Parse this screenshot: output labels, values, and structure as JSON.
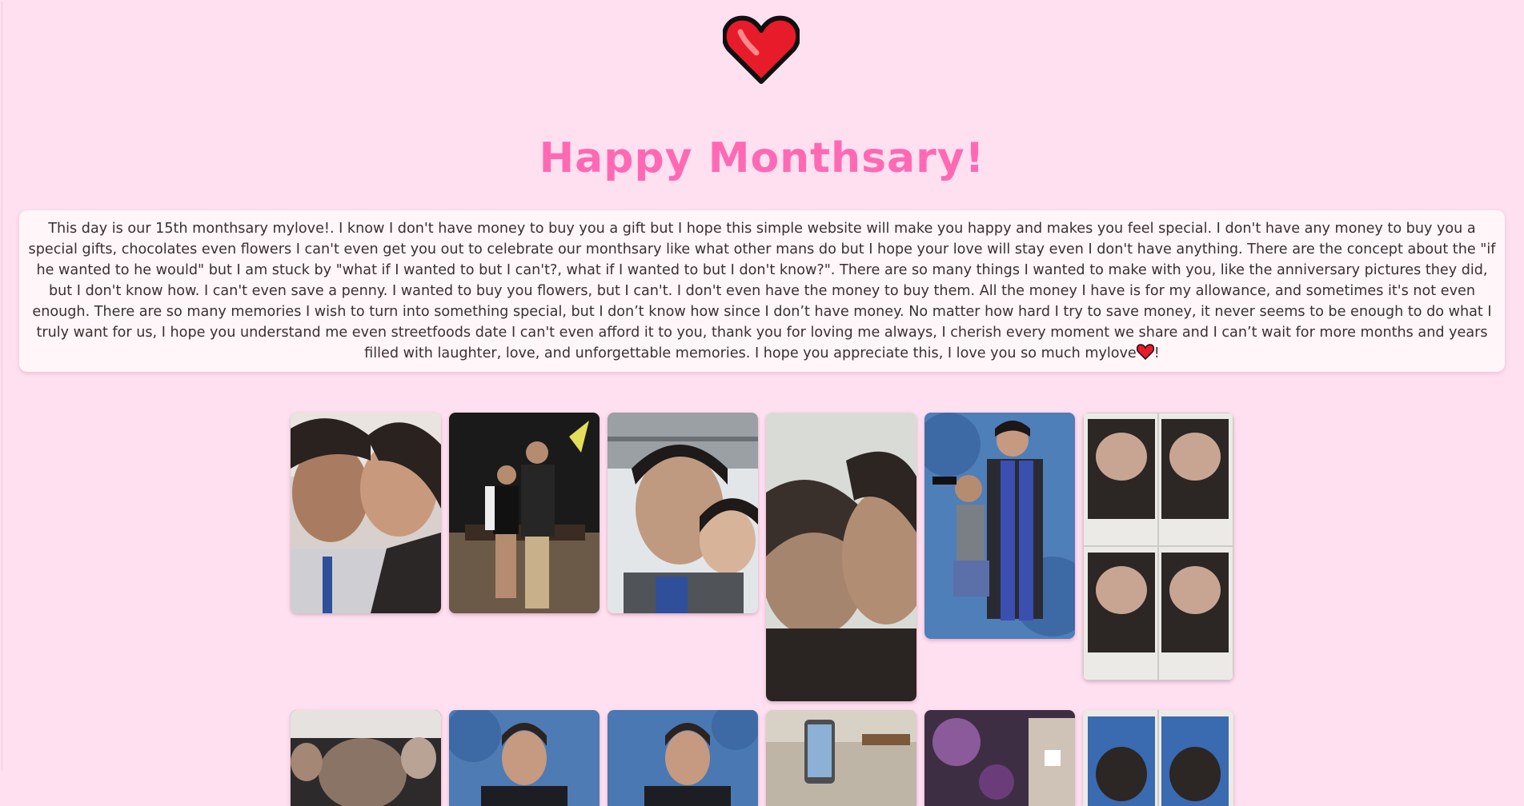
{
  "header": {
    "heart_icon": "red-heart-icon",
    "title": "Happy Monthsary!"
  },
  "letter": {
    "body": "This day is our 15th monthsary mylove!. I know I don't have money to buy you a gift but I hope this simple website will make you happy and makes you feel special. I don't have any money to buy you a special gifts, chocolates even flowers I can't even get you out to celebrate our monthsary like what other mans do but I hope your love will stay even I don't have anything. There are the concept about the \"if he wanted to he would\" but I am stuck by \"what if I wanted to but I can't?, what if I wanted to but I don't know?\". There are so many things I wanted to make with you, like the anniversary pictures they did, but I don't know how. I can't even save a penny. I wanted to buy you flowers, but I can't. I don't even have the money to buy them. All the money I have is for my allowance, and sometimes it's not even enough. There are so many memories I wish to turn into something special, but I don’t know how since I don’t have money. No matter how hard I try to save money, it never seems to be enough to do what I truly want for us, I hope you understand me even streetfoods date I can't even afford it to you, thank you for loving me always, I cherish every moment we share and I can’t wait for more months and years filled with laughter, love, and unforgettable memories. I hope you appreciate this, I love you so much mylove",
    "ending": "!",
    "ending_icon": "red-heart-icon"
  },
  "gallery": {
    "photos": [
      {
        "name": "couple-selfie-photo",
        "palette": [
          "#6e5a52",
          "#b98f79",
          "#d7d0cc"
        ]
      },
      {
        "name": "couple-night-photo",
        "palette": [
          "#1a1a1a",
          "#6b5a47",
          "#c7b08a"
        ]
      },
      {
        "name": "bus-selfie-photo",
        "palette": [
          "#9aa0a4",
          "#c8b1a0",
          "#e3e6e8"
        ]
      },
      {
        "name": "close-selfie-photo",
        "palette": [
          "#d9dcd6",
          "#5a4a40",
          "#2a2522"
        ]
      },
      {
        "name": "graduation-photo",
        "palette": [
          "#4f7fb8",
          "#2a2a33",
          "#3a4fb0"
        ]
      },
      {
        "name": "photobooth-strip-photo",
        "palette": [
          "#eceae6",
          "#2c2624",
          "#c8a592"
        ]
      },
      {
        "name": "crowd-photo",
        "palette": [
          "#2d2a2c",
          "#e6e2e0",
          "#8a7466"
        ]
      },
      {
        "name": "portrait-blue-photo-1",
        "palette": [
          "#4e7bb4",
          "#2a2320",
          "#c59a80"
        ]
      },
      {
        "name": "portrait-blue-photo-2",
        "palette": [
          "#4a78b2",
          "#2a2320",
          "#c59a80"
        ]
      },
      {
        "name": "phone-photo",
        "palette": [
          "#bfb5a6",
          "#4e4e52",
          "#d8d2c6"
        ]
      },
      {
        "name": "purple-light-photo",
        "palette": [
          "#3e2e44",
          "#8a5a9a",
          "#cfc3b7"
        ]
      },
      {
        "name": "photobooth-strip-photo-2",
        "palette": [
          "#eceae6",
          "#3a6ab0",
          "#c8a592"
        ]
      }
    ]
  }
}
